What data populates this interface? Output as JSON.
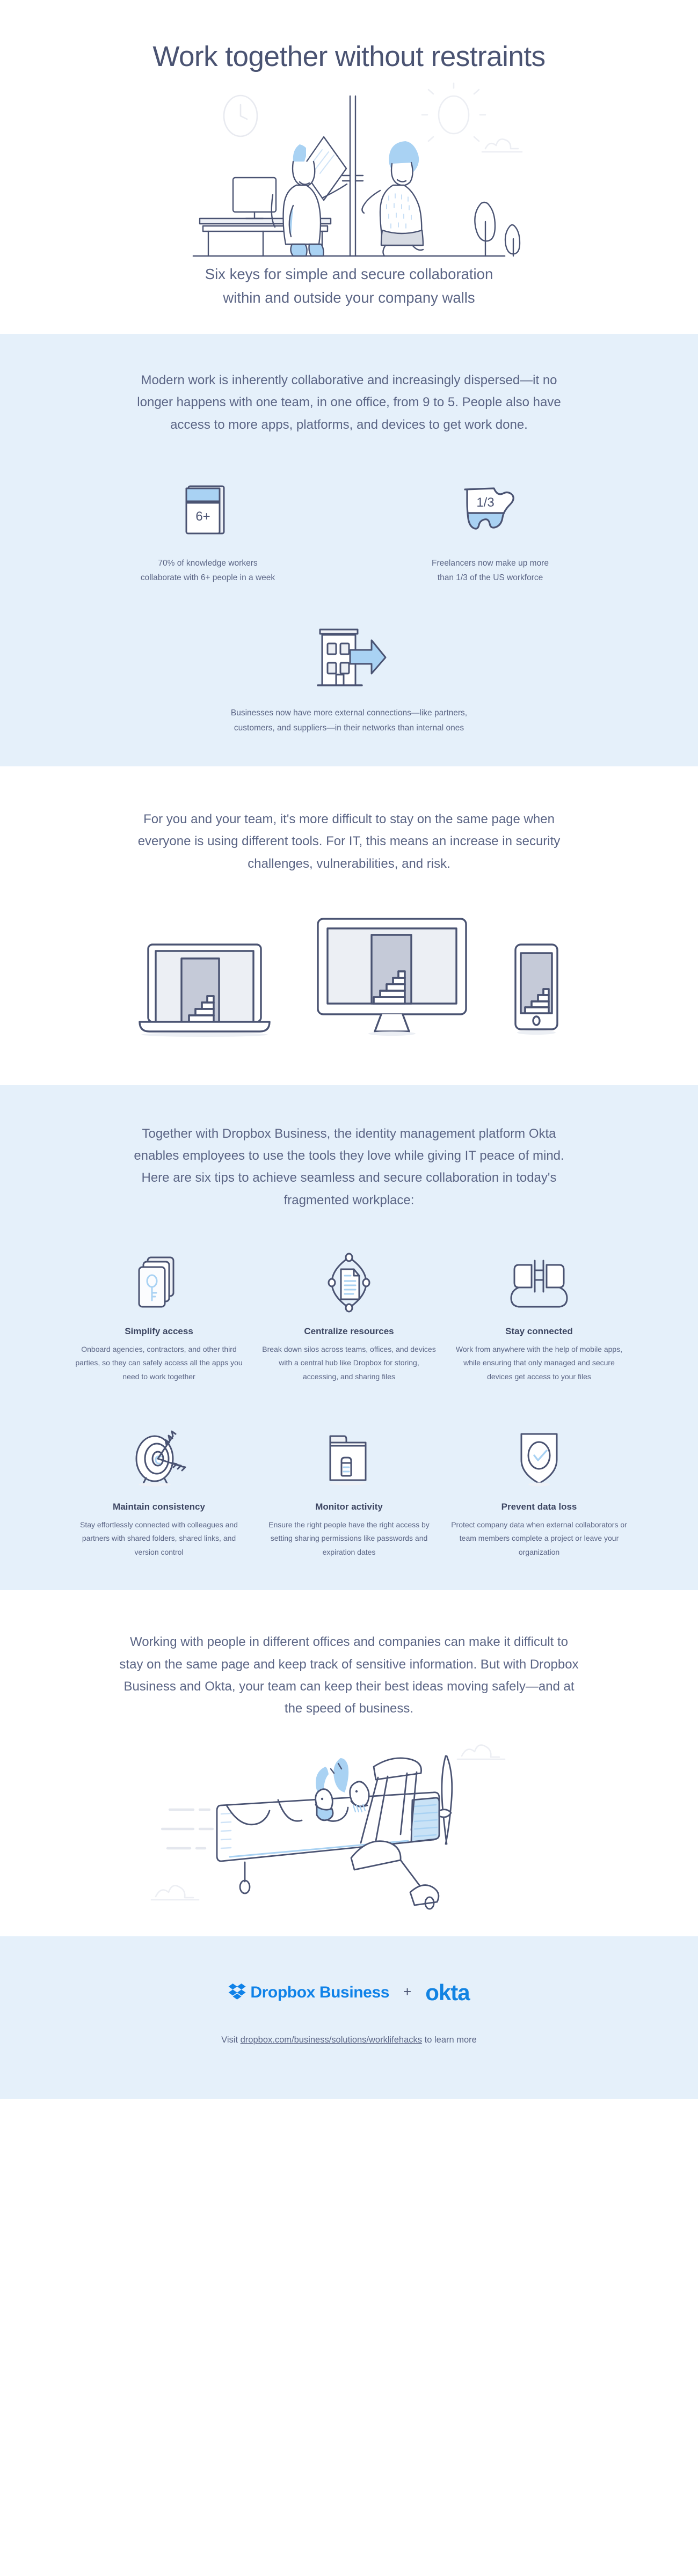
{
  "theme": {
    "ink": "#4a5372",
    "body_text": "#5b6585",
    "panel_blue": "#e5f0fa",
    "accent_blue": "#a9d2f3",
    "brand_blue": "#0f82e8",
    "white": "#ffffff"
  },
  "hero": {
    "title": "Work together without restraints",
    "subtitle_line_1": "Six keys for simple and secure collaboration",
    "subtitle_line_2": "within and outside your company walls",
    "illustration_name": "two-coworkers-at-office-door-illustration"
  },
  "section_modern_work": {
    "paragraph": "Modern work is inherently collaborative and increasingly dispersed—it no longer happens with one team, in one office, from 9 to 5. People also have access to more apps, platforms, and devices to get work done.",
    "stats": [
      {
        "icon": "stacked-cards-6-plus-icon",
        "icon_label": "6+",
        "caption_line_1": "70% of knowledge workers",
        "caption_line_2": "collaborate with 6+ people in a week"
      },
      {
        "icon": "us-map-one-third-icon",
        "icon_label": "1/3",
        "caption_line_1": "Freelancers now make up more",
        "caption_line_2": "than 1/3 of the US workforce"
      },
      {
        "icon": "office-building-outbound-arrow-icon",
        "icon_label": "",
        "caption_line_1": "Businesses now have more external connections—like partners,",
        "caption_line_2": "customers, and suppliers—in their networks than internal ones"
      }
    ]
  },
  "section_different_tools": {
    "paragraph": "For you and your team, it's more difficult to stay on the same page when everyone is using different tools. For IT, this means an increase in security challenges, vulnerabilities, and risk.",
    "devices": [
      {
        "name": "laptop-device-icon"
      },
      {
        "name": "desktop-monitor-device-icon"
      },
      {
        "name": "smartphone-device-icon"
      }
    ]
  },
  "section_tips": {
    "paragraph": "Together with Dropbox Business, the identity management platform Okta enables employees to use the tools they love while giving IT peace of mind. Here are six tips to achieve seamless and secure collaboration in today's fragmented workplace:",
    "tips": [
      {
        "icon": "key-cards-stack-icon",
        "heading": "Simplify access",
        "body": "Onboard agencies, contractors, and other third parties, so they can safely access all the apps you need to work together"
      },
      {
        "icon": "document-in-orbit-icon",
        "heading": "Centralize resources",
        "body": "Break down silos across teams, offices, and devices with a central hub like Dropbox for storing, accessing, and sharing files"
      },
      {
        "icon": "plug-and-socket-icon",
        "heading": "Stay connected",
        "body": "Work from anywhere with the help of mobile apps, while ensuring that only managed and secure devices get access to your files"
      },
      {
        "icon": "target-with-arrow-icon",
        "heading": "Maintain consistency",
        "body": "Stay effortlessly connected with colleagues and partners with shared folders, shared links, and version control"
      },
      {
        "icon": "folder-with-lock-icon",
        "heading": "Monitor activity",
        "body": "Ensure the right people have the right access by setting sharing permissions like passwords and expiration dates"
      },
      {
        "icon": "shield-with-checkmark-icon",
        "heading": "Prevent data loss",
        "body": "Protect company data when external collaborators or team members complete a project or leave your organization"
      }
    ]
  },
  "section_closing": {
    "paragraph": "Working with people in different offices and companies can make it difficult to stay on the same page and keep track of sensitive information. But with Dropbox Business and Okta, your team can keep their best ideas moving safely—and at the speed of business.",
    "illustration_name": "two-people-flying-biplane-illustration"
  },
  "footer": {
    "dropbox_logo_text": "Dropbox Business",
    "separator": "+",
    "okta_logo_text": "okta",
    "note_prefix": "Visit ",
    "note_link": "dropbox.com/business/solutions/worklifehacks",
    "note_suffix": " to learn more"
  }
}
